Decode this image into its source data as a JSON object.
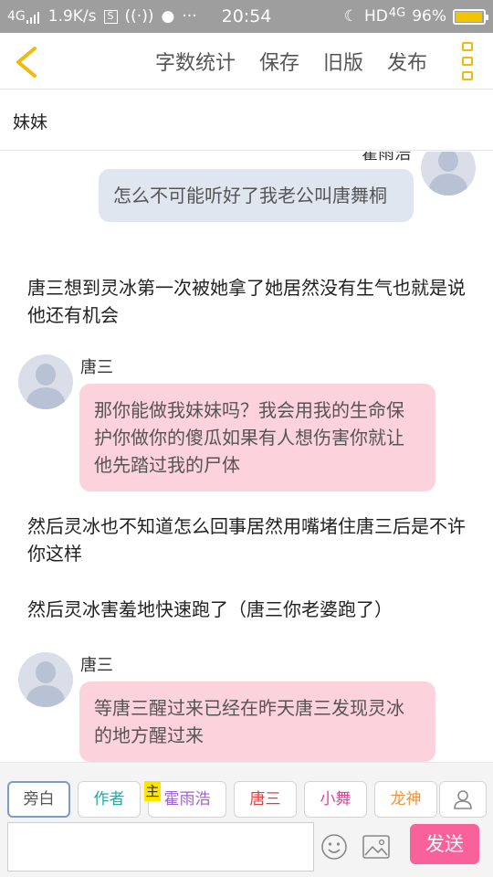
{
  "status_bar": {
    "network": "4G",
    "speed": "1.9K/s",
    "time": "20:54",
    "hd": "HD",
    "network_right": "4G",
    "battery": "96%",
    "battery_level": 0.96
  },
  "toolbar": {
    "word_count": "字数统计",
    "save": "保存",
    "old_version": "旧版",
    "publish": "发布"
  },
  "title_field": {
    "value": "妹妹"
  },
  "messages": {
    "m1_name": "霍雨浩",
    "m1_text": "怎么不可能听好了我老公叫唐舞桐",
    "n1": "唐三想到灵冰第一次被她拿了她居然没有生气也就是说他还有机会",
    "m2_name": "唐三",
    "m2_text": "那你能做我妹妹吗？我会用我的生命保护你做你的傻瓜如果有人想伤害你就让他先踏过我的尸体",
    "n2": "然后灵冰也不知道怎么回事居然用嘴堵住唐三后是不许你这样",
    "n3": "然后灵冰害羞地快速跑了（唐三你老婆跑了）",
    "m3_name": "唐三",
    "m3_text": "等唐三醒过来已经在昨天唐三发现灵冰的地方醒过来"
  },
  "roles": {
    "narrator": "旁白",
    "author": "作者",
    "main_badge": "主",
    "r1": "霍雨浩",
    "r2": "唐三",
    "r3": "小舞",
    "r4": "龙神"
  },
  "colors": {
    "author": "#22a9a0",
    "r1": "#9d62c9",
    "r2": "#e23b3b",
    "r3": "#e0449a",
    "r4": "#f0913c",
    "send": "#f8619a"
  },
  "input_bar": {
    "send": "发送"
  }
}
